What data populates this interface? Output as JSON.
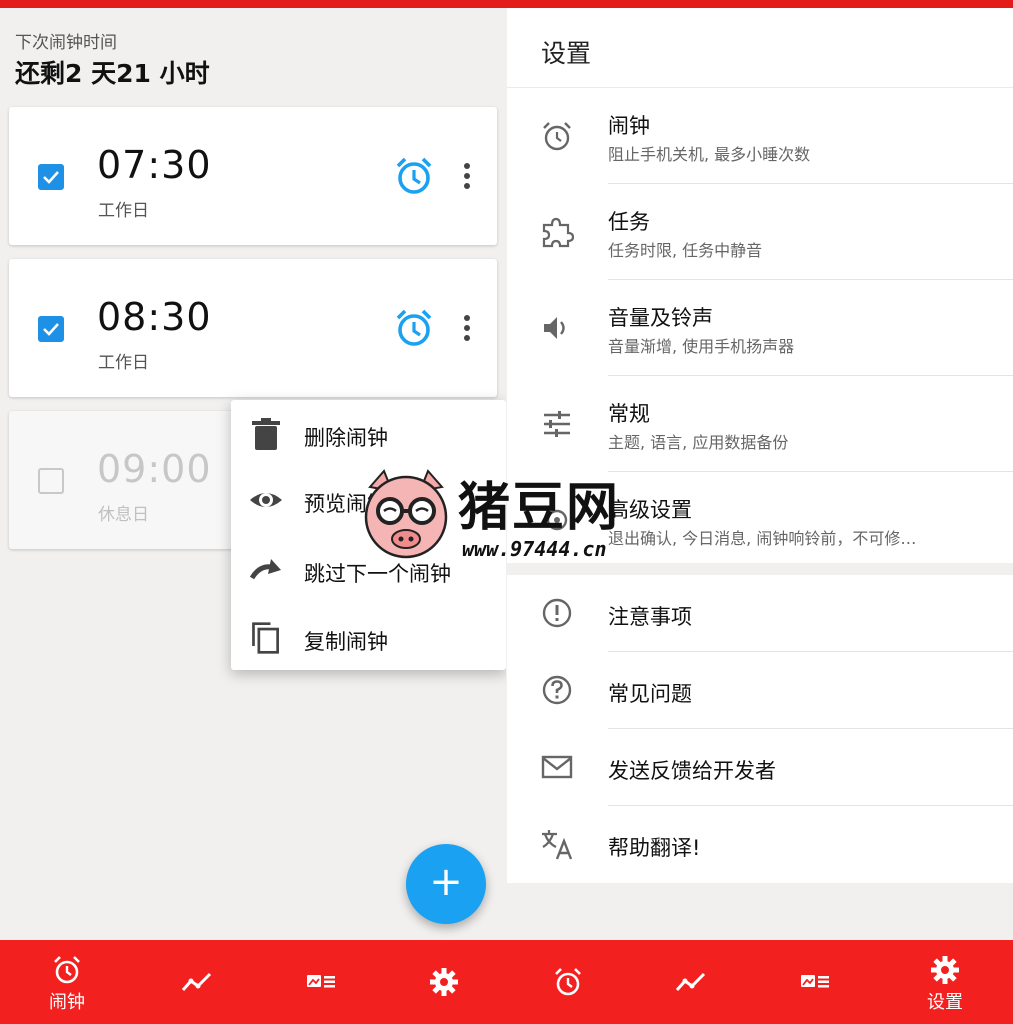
{
  "colors": {
    "accent_red": "#f2211f",
    "checkbox_blue": "#1e90e6",
    "alarm_icon_blue": "#1ba1f2",
    "fab_blue": "#1ba1f2"
  },
  "left": {
    "next_label": "下次闹钟时间",
    "next_remaining": "还剩2 天21 小时",
    "alarms": [
      {
        "time": "07:30",
        "days": "工作日",
        "enabled": true
      },
      {
        "time": "08:30",
        "days": "工作日",
        "enabled": true
      },
      {
        "time": "09:00",
        "days": "休息日",
        "enabled": false
      }
    ],
    "context_menu": [
      {
        "icon": "trash-icon",
        "label": "删除闹钟"
      },
      {
        "icon": "eye-icon",
        "label": "预览闹钟"
      },
      {
        "icon": "redo-icon",
        "label": "跳过下一个闹钟"
      },
      {
        "icon": "copy-icon",
        "label": "复制闹钟"
      }
    ],
    "fab_label": "+"
  },
  "settings": {
    "title": "设置",
    "rows": [
      {
        "icon": "alarm-clock-icon",
        "title": "闹钟",
        "subtitle": "阻止手机关机, 最多小睡次数"
      },
      {
        "icon": "puzzle-icon",
        "title": "任务",
        "subtitle": "任务时限, 任务中静音"
      },
      {
        "icon": "volume-icon",
        "title": "音量及铃声",
        "subtitle": "音量渐增, 使用手机扬声器"
      },
      {
        "icon": "sliders-icon",
        "title": "常规",
        "subtitle": "主题, 语言, 应用数据备份"
      },
      {
        "icon": "gear-outline-icon",
        "title": "高级设置",
        "subtitle": "退出确认, 今日消息, 闹钟响铃前，不可修…"
      }
    ],
    "more_rows": [
      {
        "icon": "exclamation-circle-icon",
        "title": "注意事项"
      },
      {
        "icon": "question-circle-icon",
        "title": "常见问题"
      },
      {
        "icon": "mail-icon",
        "title": "发送反馈给开发者"
      },
      {
        "icon": "translate-icon",
        "title": "帮助翻译!"
      }
    ]
  },
  "nav_left": [
    {
      "icon": "alarm-clock-icon",
      "label": "闹钟",
      "active": true
    },
    {
      "icon": "trend-icon",
      "label": "",
      "active": false
    },
    {
      "icon": "news-icon",
      "label": "",
      "active": false
    },
    {
      "icon": "settings-gear-icon",
      "label": "",
      "active": false
    }
  ],
  "nav_right": [
    {
      "icon": "alarm-clock-icon",
      "label": "",
      "active": false
    },
    {
      "icon": "trend-icon",
      "label": "",
      "active": false
    },
    {
      "icon": "news-icon",
      "label": "",
      "active": false
    },
    {
      "icon": "settings-gear-icon",
      "label": "设置",
      "active": true
    }
  ],
  "watermark": {
    "text": "猪豆网",
    "url": "www.97444.cn"
  }
}
